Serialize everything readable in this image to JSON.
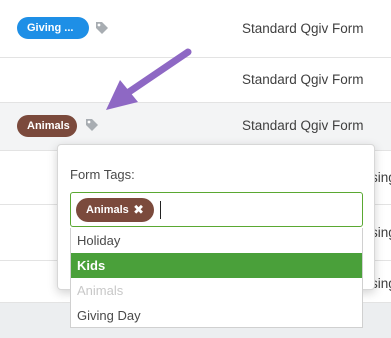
{
  "rows": [
    {
      "tag": "Giving ...",
      "form_type": "Standard Qgiv Form"
    },
    {
      "form_type": "Standard Qgiv Form"
    },
    {
      "tag": "Animals",
      "form_type": "Standard Qgiv Form"
    },
    {
      "form_type_partial": "sing"
    },
    {
      "form_type_partial": "sing"
    },
    {
      "form_type_partial": "sing"
    }
  ],
  "colors": {
    "tag_blue": "#1e8fe6",
    "tag_brown": "#7b4a3c",
    "highlight_green": "#4aa03a",
    "arrow_purple": "#8e68c4"
  },
  "popup": {
    "label": "Form Tags:",
    "selected_chip": "Animals",
    "remove_glyph": "✖",
    "options": [
      {
        "label": "Holiday",
        "state": "normal"
      },
      {
        "label": "Kids",
        "state": "highlighted"
      },
      {
        "label": "Animals",
        "state": "disabled"
      },
      {
        "label": "Giving Day",
        "state": "normal"
      }
    ]
  },
  "icons": {
    "tag": "tag-icon",
    "arrow": "annotation-arrow"
  }
}
